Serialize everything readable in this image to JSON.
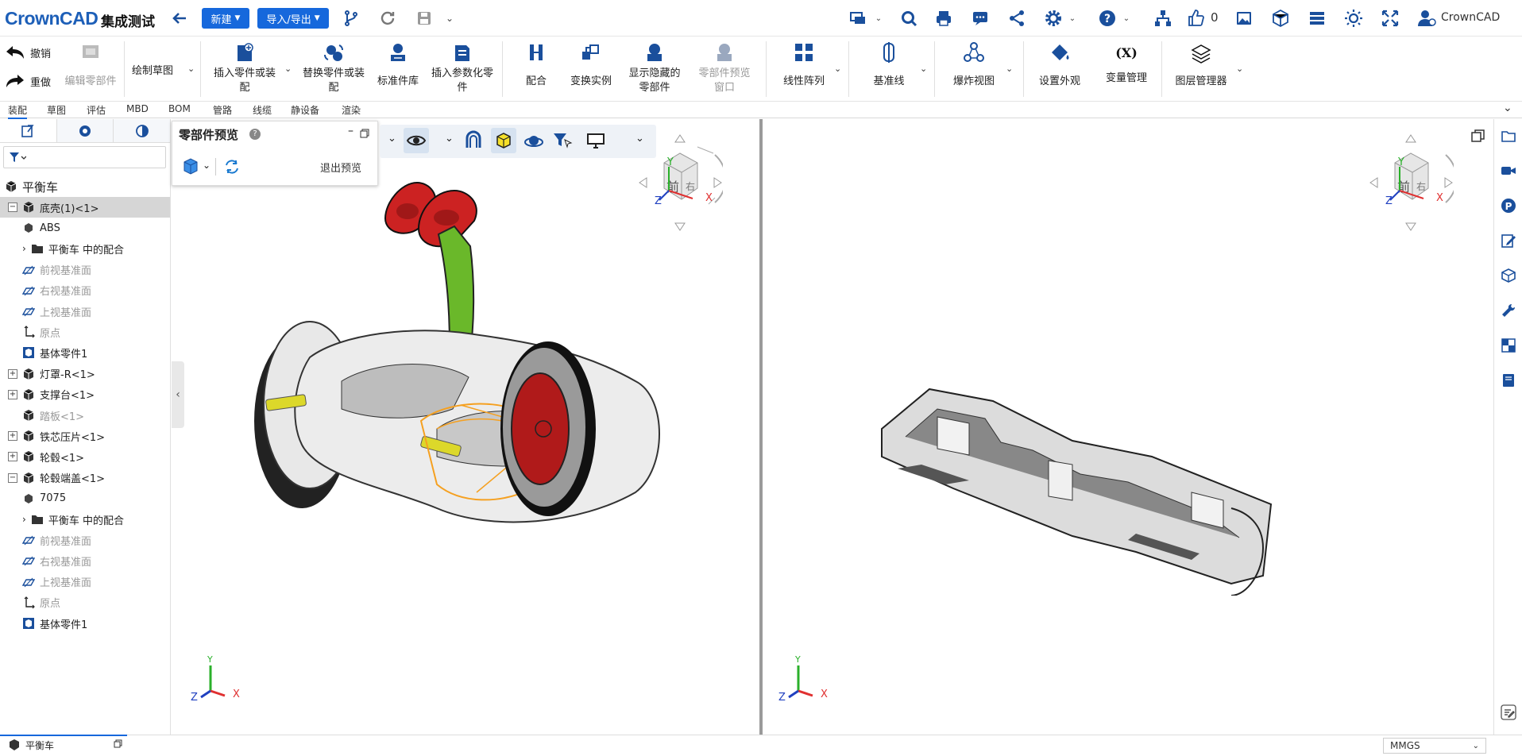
{
  "app": {
    "logo": "CrownCAD",
    "document_title": "集成测试",
    "new_button": "新建",
    "import_export_button": "导入/导出",
    "like_count": "0",
    "user_name": "CrownCAD"
  },
  "ribbon": {
    "undo": "撤销",
    "redo": "重做",
    "edit_part": "编辑零部件",
    "sketch": "绘制草图",
    "insert_part": "插入零件或装配",
    "replace_part": "替换零件或装配",
    "standard_lib": "标准件库",
    "insert_param": "插入参数化零件",
    "mate": "配合",
    "transform_instance": "变换实例",
    "show_hidden": "显示隐藏的零部件",
    "part_preview_window": "零部件预览窗口",
    "linear_pattern": "线性阵列",
    "datum_line": "基准线",
    "explode_view": "爆炸视图",
    "set_appearance": "设置外观",
    "variable_manager": "变量管理",
    "layer_manager": "图层管理器"
  },
  "tabs": [
    "装配",
    "草图",
    "评估",
    "MBD",
    "BOM",
    "管路",
    "线缆",
    "静设备",
    "渲染"
  ],
  "tree": {
    "root": "平衡车",
    "items": [
      {
        "label": "底壳(1)<1>",
        "level": 0,
        "type": "part",
        "expander": "−",
        "selected": true
      },
      {
        "label": "ABS",
        "level": 1,
        "type": "material"
      },
      {
        "label": "平衡车 中的配合",
        "level": 1,
        "type": "folder",
        "arrow": true
      },
      {
        "label": "前视基准面",
        "level": 1,
        "type": "plane",
        "gray": true
      },
      {
        "label": "右视基准面",
        "level": 1,
        "type": "plane",
        "gray": true
      },
      {
        "label": "上视基准面",
        "level": 1,
        "type": "plane",
        "gray": true
      },
      {
        "label": "原点",
        "level": 1,
        "type": "origin",
        "gray": true
      },
      {
        "label": "基体零件1",
        "level": 1,
        "type": "body"
      },
      {
        "label": "灯罩-R<1>",
        "level": 0,
        "type": "part",
        "expander": "+"
      },
      {
        "label": "支撑台<1>",
        "level": 0,
        "type": "part",
        "expander": "+"
      },
      {
        "label": "踏板<1>",
        "level": 0,
        "type": "part",
        "gray": true
      },
      {
        "label": "铁芯压片<1>",
        "level": 0,
        "type": "part",
        "expander": "+"
      },
      {
        "label": "轮毂<1>",
        "level": 0,
        "type": "part",
        "expander": "+"
      },
      {
        "label": "轮毂端盖<1>",
        "level": 0,
        "type": "part",
        "expander": "−"
      },
      {
        "label": "7075",
        "level": 1,
        "type": "material"
      },
      {
        "label": "平衡车 中的配合",
        "level": 1,
        "type": "folder",
        "arrow": true
      },
      {
        "label": "前视基准面",
        "level": 1,
        "type": "plane",
        "gray": true
      },
      {
        "label": "右视基准面",
        "level": 1,
        "type": "plane",
        "gray": true
      },
      {
        "label": "上视基准面",
        "level": 1,
        "type": "plane",
        "gray": true
      },
      {
        "label": "原点",
        "level": 1,
        "type": "origin",
        "gray": true
      },
      {
        "label": "基体零件1",
        "level": 1,
        "type": "body"
      }
    ]
  },
  "preview_panel": {
    "title": "零部件预览",
    "help": "?",
    "exit": "退出预览"
  },
  "viewcube": {
    "face": "前",
    "side": "右",
    "x": "X",
    "y": "Y",
    "z": "Z"
  },
  "bottom_tab": "平衡车",
  "status": {
    "units": "MMGS"
  },
  "colors": {
    "accent": "#1668dc",
    "handle_red": "#cc2222",
    "stem_green": "#6ab82a",
    "highlight_orange": "#f5a020"
  }
}
